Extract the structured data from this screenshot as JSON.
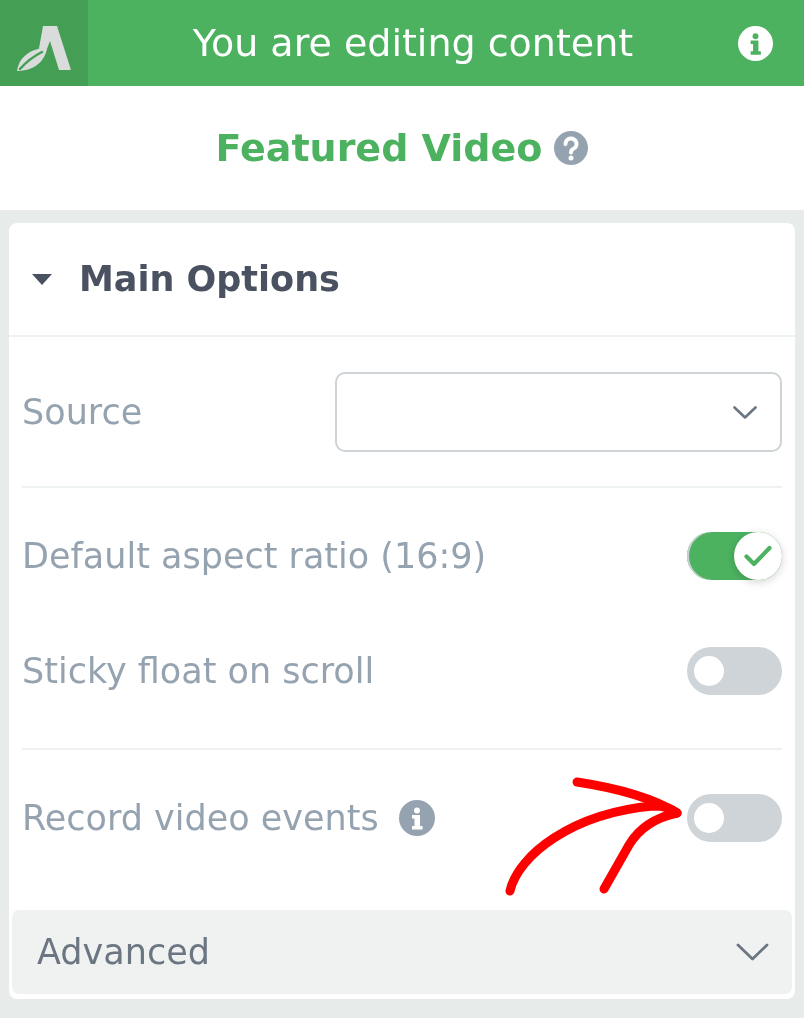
{
  "header": {
    "title": "You are editing content"
  },
  "panel": {
    "title": "Featured Video"
  },
  "sections": [
    {
      "title": "Main Options",
      "expanded": true,
      "groups": [
        {
          "fields": [
            {
              "kind": "select",
              "label": "Source",
              "info": false,
              "annotated": false
            }
          ]
        },
        {
          "fields": [
            {
              "kind": "toggle",
              "label": "Default aspect ratio (16:9)",
              "on": true,
              "info": false,
              "annotated": false
            },
            {
              "kind": "toggle",
              "label": "Sticky float on scroll",
              "on": false,
              "info": false,
              "annotated": false
            }
          ]
        },
        {
          "fields": [
            {
              "kind": "toggle",
              "label": "Record video events",
              "on": false,
              "info": true,
              "annotated": true
            }
          ]
        }
      ]
    },
    {
      "title": "Advanced",
      "expanded": false
    }
  ]
}
